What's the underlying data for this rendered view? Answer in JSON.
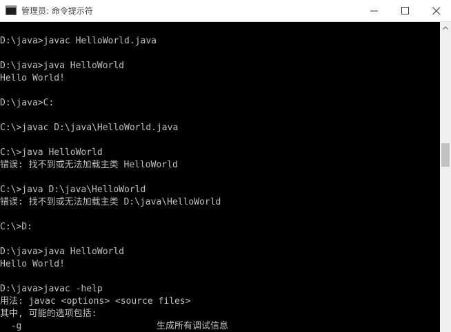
{
  "window": {
    "title": "管理员: 命令提示符",
    "icon": "cmd-icon",
    "icon_text": "C:\\"
  },
  "controls": {
    "minimize_icon": "minimize-icon",
    "maximize_icon": "maximize-icon",
    "close_icon": "close-icon"
  },
  "console": {
    "background": "#000000",
    "foreground": "#c0c0c0",
    "lines": [
      "",
      "D:\\java>javac HelloWorld.java",
      "",
      "D:\\java>java HelloWorld",
      "Hello World!",
      "",
      "D:\\java>C:",
      "",
      "C:\\>javac D:\\java\\HelloWorld.java",
      "",
      "C:\\>java HelloWorld",
      "错误: 找不到或无法加载主类 HelloWorld",
      "",
      "C:\\>java D:\\java\\HelloWorld",
      "错误: 找不到或无法加载主类 D:\\java\\HelloWorld",
      "",
      "C:\\>D:",
      "",
      "D:\\java>java HelloWorld",
      "Hello World!",
      "",
      "D:\\java>javac -help",
      "用法: javac <options> <source files>",
      "其中, 可能的选项包括:",
      "  -g                         生成所有调试信息"
    ]
  },
  "scrollbar": {
    "up_icon": "scroll-up-arrow-icon"
  }
}
